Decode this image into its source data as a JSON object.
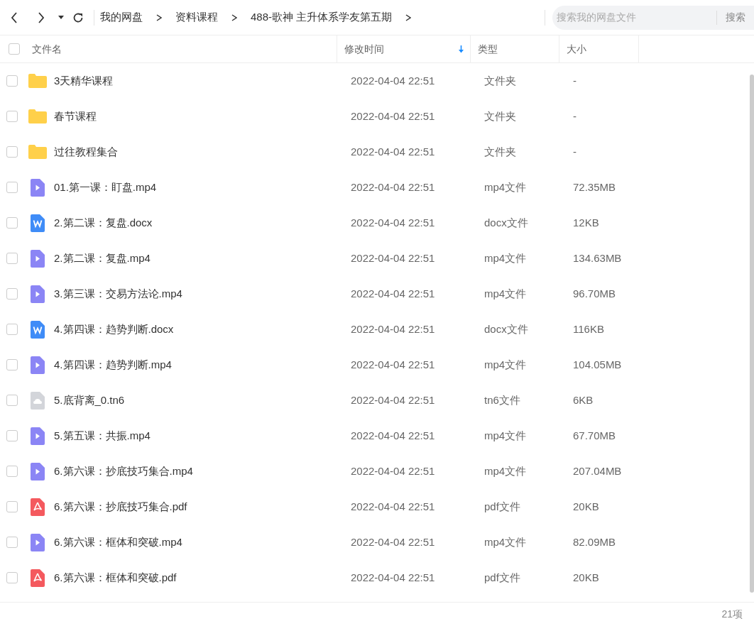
{
  "toolbar": {
    "breadcrumbs": [
      "我的网盘",
      "资料课程",
      "488-歌神 主升体系学友第五期"
    ],
    "search": {
      "placeholder": "搜索我的网盘文件",
      "button": "搜索"
    }
  },
  "table": {
    "select_all_checked": false,
    "columns": [
      {
        "label": "文件名",
        "sorted": false
      },
      {
        "label": "修改时间",
        "sorted": true
      },
      {
        "label": "类型",
        "sorted": false
      },
      {
        "label": "大小",
        "sorted": false
      }
    ],
    "rows": [
      {
        "kind": "folder",
        "name": "3天精华课程",
        "modified": "2022-04-04 22:51",
        "type": "文件夹",
        "size": "-",
        "checked": false
      },
      {
        "kind": "folder",
        "name": "春节课程",
        "modified": "2022-04-04 22:51",
        "type": "文件夹",
        "size": "-",
        "checked": false
      },
      {
        "kind": "folder",
        "name": "过往教程集合",
        "modified": "2022-04-04 22:51",
        "type": "文件夹",
        "size": "-",
        "checked": false
      },
      {
        "kind": "video",
        "name": "01.第一课：盯盘.mp4",
        "modified": "2022-04-04 22:51",
        "type": "mp4文件",
        "size": "72.35MB",
        "checked": false
      },
      {
        "kind": "doc",
        "name": "2.第二课：复盘.docx",
        "modified": "2022-04-04 22:51",
        "type": "docx文件",
        "size": "12KB",
        "checked": false
      },
      {
        "kind": "video",
        "name": "2.第二课：复盘.mp4",
        "modified": "2022-04-04 22:51",
        "type": "mp4文件",
        "size": "134.63MB",
        "checked": false
      },
      {
        "kind": "video",
        "name": "3.第三课：交易方法论.mp4",
        "modified": "2022-04-04 22:51",
        "type": "mp4文件",
        "size": "96.70MB",
        "checked": false
      },
      {
        "kind": "doc",
        "name": "4.第四课：趋势判断.docx",
        "modified": "2022-04-04 22:51",
        "type": "docx文件",
        "size": "116KB",
        "checked": false
      },
      {
        "kind": "video",
        "name": "4.第四课：趋势判断.mp4",
        "modified": "2022-04-04 22:51",
        "type": "mp4文件",
        "size": "104.05MB",
        "checked": false
      },
      {
        "kind": "file",
        "name": "5.底背离_0.tn6",
        "modified": "2022-04-04 22:51",
        "type": "tn6文件",
        "size": "6KB",
        "checked": false
      },
      {
        "kind": "video",
        "name": "5.第五课：共振.mp4",
        "modified": "2022-04-04 22:51",
        "type": "mp4文件",
        "size": "67.70MB",
        "checked": false
      },
      {
        "kind": "video",
        "name": "6.第六课：抄底技巧集合.mp4",
        "modified": "2022-04-04 22:51",
        "type": "mp4文件",
        "size": "207.04MB",
        "checked": false
      },
      {
        "kind": "pdf",
        "name": "6.第六课：抄底技巧集合.pdf",
        "modified": "2022-04-04 22:51",
        "type": "pdf文件",
        "size": "20KB",
        "checked": false
      },
      {
        "kind": "video",
        "name": "6.第六课：框体和突破.mp4",
        "modified": "2022-04-04 22:51",
        "type": "mp4文件",
        "size": "82.09MB",
        "checked": false
      },
      {
        "kind": "pdf",
        "name": "6.第六课：框体和突破.pdf",
        "modified": "2022-04-04 22:51",
        "type": "pdf文件",
        "size": "20KB",
        "checked": false
      }
    ]
  },
  "status_bar": {
    "count": "21项"
  }
}
